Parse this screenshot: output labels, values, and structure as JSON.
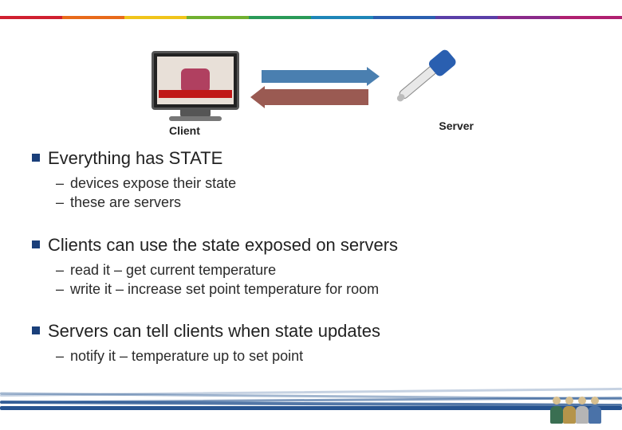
{
  "rainbow": [
    "#d02030",
    "#e86a1a",
    "#f0c41a",
    "#70b030",
    "#2a9a58",
    "#1e86b8",
    "#2a5fb0",
    "#5a3fa8",
    "#8a2a8a",
    "#b02070"
  ],
  "diagram": {
    "client_label": "Client",
    "server_label": "Server"
  },
  "bullets": [
    {
      "title": "Everything has STATE",
      "subs": [
        "devices expose their state",
        "these are servers"
      ]
    },
    {
      "title": "Clients can use the state exposed on servers",
      "subs": [
        "read it – get current temperature",
        "write it – increase set point temperature for room"
      ]
    },
    {
      "title": "Servers can tell clients when state updates",
      "subs": [
        "notify it – temperature up to set point"
      ]
    }
  ]
}
